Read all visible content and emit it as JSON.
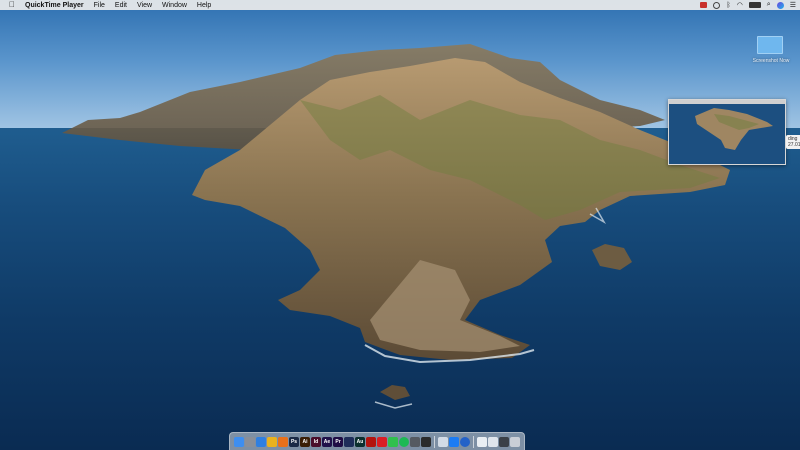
{
  "menubar": {
    "apple_icon": "apple-icon",
    "app_name": "QuickTime Player",
    "menus": [
      "File",
      "Edit",
      "View",
      "Window",
      "Help"
    ],
    "status_icons": [
      "record-icon",
      "time-machine-icon",
      "bluetooth-icon",
      "wifi-icon",
      "battery-icon",
      "search-icon",
      "siri-icon",
      "notification-center-icon"
    ]
  },
  "desktop": {
    "file_label": "Screenshot Now",
    "screenshot_edge_label": "ding 27.01"
  },
  "dock": {
    "items": [
      {
        "name": "finder-icon",
        "color": "#3d8ef0",
        "glyph": ""
      },
      {
        "name": "launchpad-icon",
        "color": "#8a8f98",
        "glyph": ""
      },
      {
        "name": "safari-icon",
        "color": "#2f7fe0",
        "glyph": ""
      },
      {
        "name": "chrome-icon",
        "color": "#e9b21d",
        "glyph": ""
      },
      {
        "name": "firefox-icon",
        "color": "#e8701a",
        "glyph": ""
      },
      {
        "name": "photoshop-icon",
        "color": "#1b2a46",
        "glyph": "Ps"
      },
      {
        "name": "illustrator-icon",
        "color": "#3a1e06",
        "glyph": "Ai"
      },
      {
        "name": "indesign-icon",
        "color": "#4a0d2a",
        "glyph": "Id"
      },
      {
        "name": "after-effects-icon",
        "color": "#20114a",
        "glyph": "Ae"
      },
      {
        "name": "premiere-icon",
        "color": "#1f0d45",
        "glyph": "Pr"
      },
      {
        "name": "media-encoder-icon",
        "color": "#1e2d5a",
        "glyph": ""
      },
      {
        "name": "audition-icon",
        "color": "#0b2f2e",
        "glyph": "Au"
      },
      {
        "name": "acrobat-icon",
        "color": "#b3140f",
        "glyph": ""
      },
      {
        "name": "creative-cloud-icon",
        "color": "#da1f26",
        "glyph": ""
      },
      {
        "name": "messages-icon",
        "color": "#31c04d",
        "glyph": ""
      },
      {
        "name": "spotify-icon",
        "color": "#1db954",
        "glyph": ""
      },
      {
        "name": "calculator-icon",
        "color": "#555a61",
        "glyph": ""
      },
      {
        "name": "terminal-icon",
        "color": "#2b2b2b",
        "glyph": ""
      },
      {
        "name": "preview-icon",
        "color": "#d3dbe6",
        "glyph": ""
      },
      {
        "name": "app-store-icon",
        "color": "#1c7cf4",
        "glyph": ""
      },
      {
        "name": "quicktime-icon",
        "color": "#2462c8",
        "glyph": ""
      },
      {
        "name": "window-thumb-1-icon",
        "color": "#e9eef3",
        "glyph": ""
      },
      {
        "name": "window-thumb-2-icon",
        "color": "#dfe5ec",
        "glyph": ""
      },
      {
        "name": "window-thumb-3-icon",
        "color": "#3a4048",
        "glyph": ""
      },
      {
        "name": "trash-icon",
        "color": "#c9ced6",
        "glyph": ""
      }
    ]
  }
}
